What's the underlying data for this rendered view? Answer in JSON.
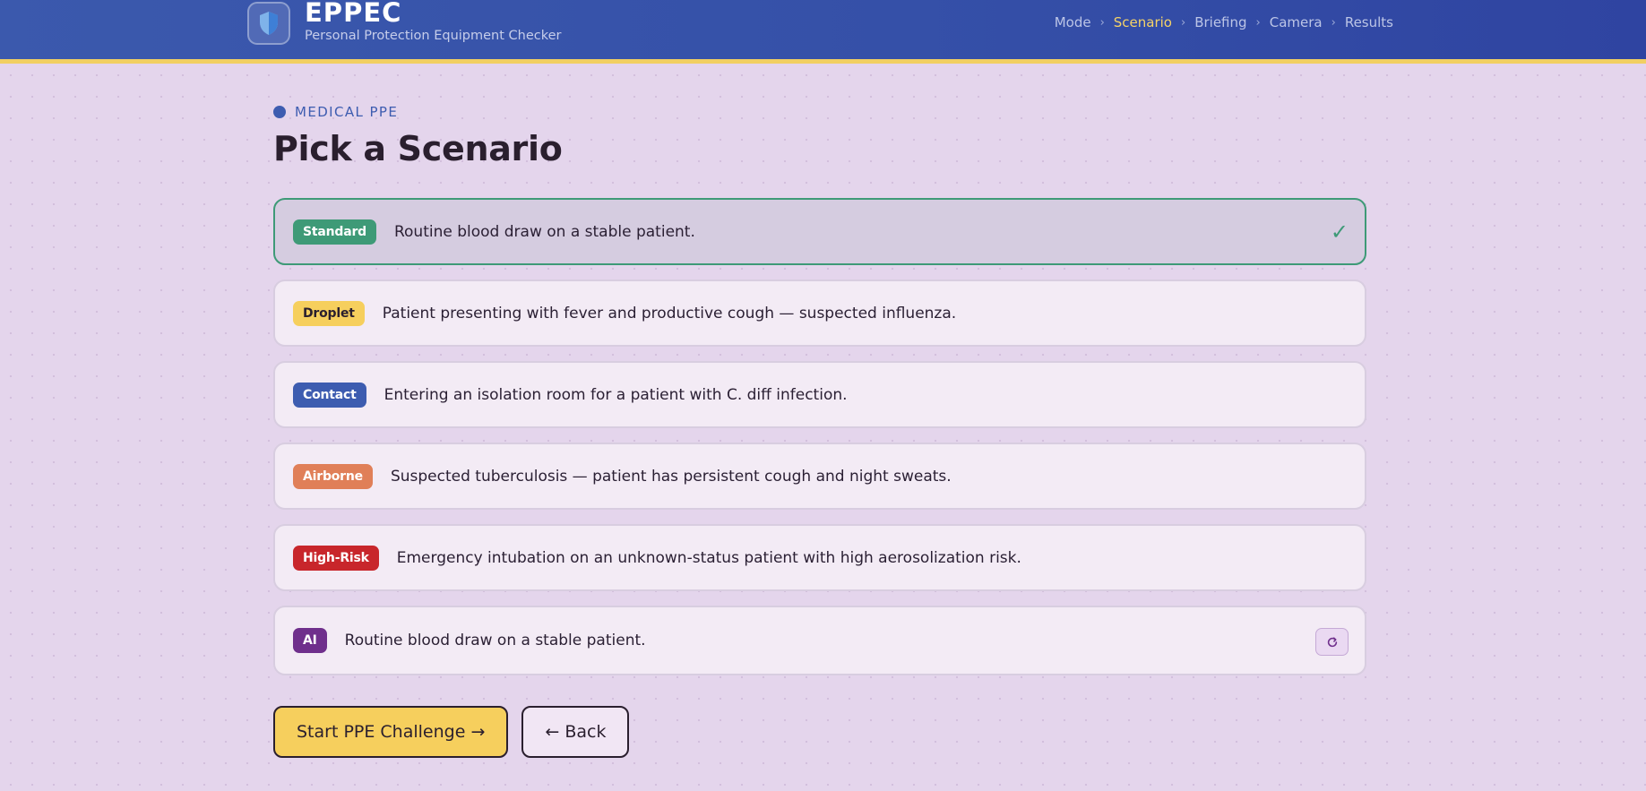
{
  "app": {
    "title": "EPPEC",
    "subtitle": "Personal Protection Equipment Checker"
  },
  "nav": {
    "steps": [
      "Mode",
      "Scenario",
      "Briefing",
      "Camera",
      "Results"
    ],
    "active": "Scenario",
    "separator": "›"
  },
  "page": {
    "eyebrow": "MEDICAL PPE",
    "title": "Pick a Scenario"
  },
  "scenarios": [
    {
      "tag": "Standard",
      "text": "Routine blood draw on a stable patient.",
      "color": "#3e9a77",
      "selected": true
    },
    {
      "tag": "Droplet",
      "text": "Patient presenting with fever and productive cough — suspected influenza.",
      "color": "#f6cf5d"
    },
    {
      "tag": "Contact",
      "text": "Entering an isolation room for a patient with C. diff infection.",
      "color": "#3d5cb0"
    },
    {
      "tag": "Airborne",
      "text": "Suspected tuberculosis — patient has persistent cough and night sweats.",
      "color": "#e07f58"
    },
    {
      "tag": "High-Risk",
      "text": "Emergency intubation on an unknown-status patient with high aerosolization risk.",
      "color": "#c8262b"
    },
    {
      "tag": "AI",
      "text": "Routine blood draw on a stable patient.",
      "color": "#6f2f8c"
    }
  ],
  "icons": {
    "logo": "shield-icon",
    "selected": "checkmark-icon",
    "regenerate": "refresh-icon"
  },
  "actions": {
    "start": "Start PPE Challenge →",
    "back": "← Back"
  },
  "colors": {
    "header": "#3550a8",
    "accent_yellow": "#f6cf5d",
    "selected_border": "#3e9a77",
    "background": "#e4d5ec"
  }
}
